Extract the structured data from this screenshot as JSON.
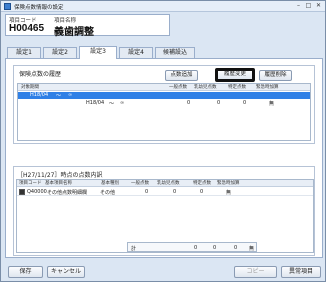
{
  "window": {
    "title": "保険点数情報の設定",
    "buttons": {
      "minimize": "–",
      "maximize": "□",
      "close": "✕"
    }
  },
  "item": {
    "code_label": "項目コード",
    "name_label": "項目名称",
    "code": "H00465",
    "name": "義歯調整"
  },
  "tabs": [
    {
      "label": "設定1"
    },
    {
      "label": "設定2"
    },
    {
      "label": "設定3",
      "active": true
    },
    {
      "label": "設定4"
    },
    {
      "label": "候補設込"
    }
  ],
  "history": {
    "title": "保険点数の履歴",
    "buttons": {
      "add": "点数追加",
      "change": "履歴変更",
      "delete": "履歴削除"
    },
    "columns": [
      "対象期間",
      "一般点数",
      "乳幼児点数",
      "特定点数",
      "緊急時加算"
    ],
    "rows": [
      {
        "start": "H18/04",
        "sep": "～",
        "end": "∞",
        "general": "",
        "infant": "",
        "specific": "",
        "emergency": "",
        "selected": true
      },
      {
        "start": "H18/04",
        "sep": "～",
        "end": "∞",
        "general": "0",
        "infant": "0",
        "specific": "0",
        "emergency": "無",
        "selected": false
      }
    ]
  },
  "detail": {
    "title": "［H27/11/27］時点の点数内訳",
    "columns": [
      "項目コード",
      "基本項目名称",
      "基本種別",
      "一般点数",
      "乳幼児点数",
      "特定点数",
      "緊急時加算"
    ],
    "rows": [
      {
        "code": "Q40000",
        "name": "その他点数明細欄",
        "type": "その他",
        "general": "0",
        "infant": "0",
        "specific": "0",
        "emergency": "無"
      }
    ],
    "total": {
      "label": "計",
      "general": "0",
      "infant": "0",
      "specific": "0",
      "emergency": "無"
    }
  },
  "footer": {
    "save": "保存",
    "cancel": "キャンセル",
    "copy": "コピー",
    "print": "異常項目"
  }
}
